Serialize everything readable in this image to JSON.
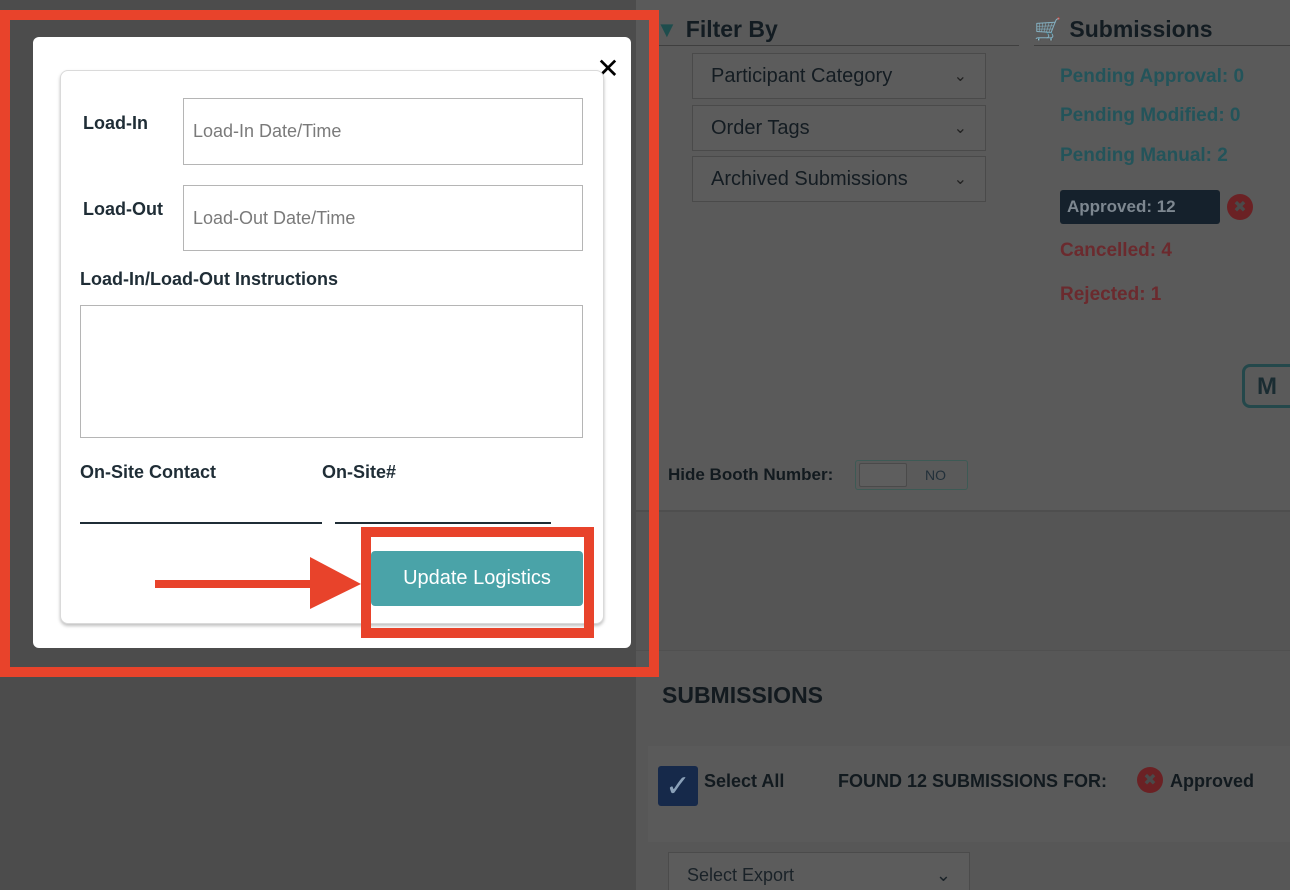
{
  "background": {
    "filter_by": {
      "title": "Filter By",
      "dropdowns": [
        "Participant Category",
        "Order Tags",
        "Archived Submissions"
      ]
    },
    "submissions_summary": {
      "title": "Submissions",
      "pending_approval": "Pending Approval: 0",
      "pending_modified": "Pending Modified: 0",
      "pending_manual": "Pending Manual: 2",
      "approved": "Approved: 12",
      "cancelled": "Cancelled: 4",
      "rejected": "Rejected: 1",
      "partial_button": "M"
    },
    "hide_booth_number": {
      "label": "Hide Booth Number:",
      "toggle_state": "NO"
    },
    "submissions_list": {
      "heading": "SUBMISSIONS",
      "select_all": "Select All",
      "found_text": "FOUND 12 SUBMISSIONS FOR:",
      "filter_tag": "Approved",
      "export_select": "Select Export"
    }
  },
  "modal": {
    "close_symbol": "✕",
    "load_in": {
      "label": "Load-In",
      "value": "",
      "placeholder": "Load-In Date/Time"
    },
    "load_out": {
      "label": "Load-Out",
      "value": "",
      "placeholder": "Load-Out Date/Time"
    },
    "instructions": {
      "label": "Load-In/Load-Out Instructions",
      "value": ""
    },
    "onsite_contact": {
      "label": "On-Site Contact",
      "value": ""
    },
    "onsite_number": {
      "label": "On-Site#",
      "value": ""
    },
    "submit_label": "Update Logistics"
  },
  "colors": {
    "accent_teal": "#4aa3a8",
    "annotation_red": "#e8432b",
    "approved_navy": "#1b2836"
  }
}
